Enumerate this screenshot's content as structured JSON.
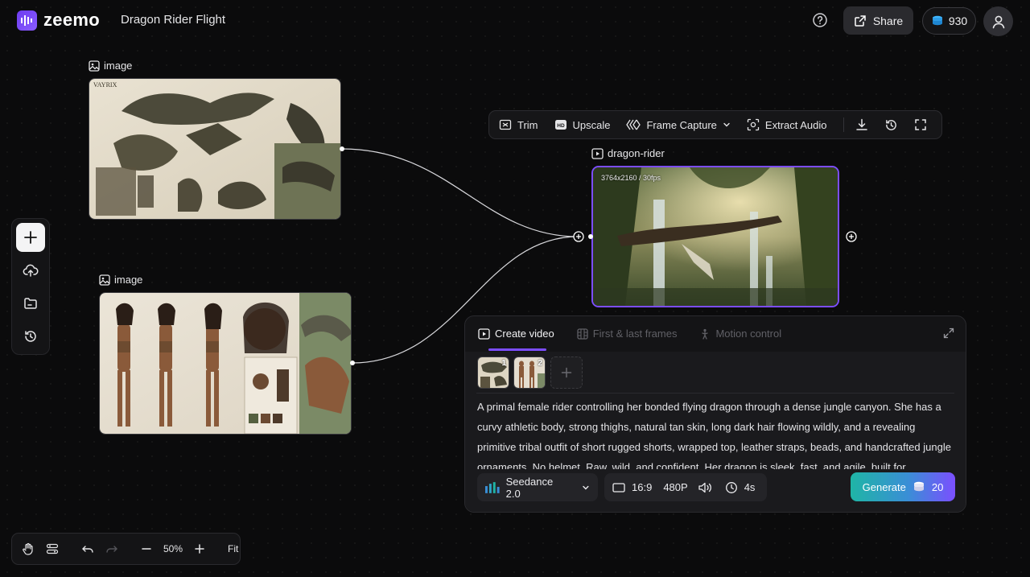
{
  "header": {
    "logo_text": "zeemo",
    "project_title": "Dragon Rider Flight",
    "share_label": "Share",
    "credits": "930"
  },
  "nodes": {
    "image1": {
      "label": "image"
    },
    "image2": {
      "label": "image"
    },
    "video": {
      "label": "dragon-rider",
      "meta": "3764x2160 / 30fps"
    }
  },
  "sidebar": {
    "items": [
      "add-icon",
      "upload-icon",
      "folder-icon",
      "history-icon"
    ]
  },
  "toolbar": {
    "trim": "Trim",
    "upscale": "Upscale",
    "frame_capture": "Frame Capture",
    "extract_audio": "Extract Audio"
  },
  "panel": {
    "tabs": [
      {
        "label": "Create video",
        "active": true
      },
      {
        "label": "First & last frames",
        "active": false
      },
      {
        "label": "Motion control",
        "active": false
      }
    ],
    "thumbs": [
      "1",
      "2"
    ],
    "prompt": "A primal female rider controlling her bonded flying dragon through a dense jungle canyon. She has a curvy athletic body, strong thighs, natural tan skin, long dark hair flowing wildly, and a revealing primitive tribal outfit of short rugged shorts, wrapped top, leather straps, beads, and handcrafted jungle ornaments. No helmet. Raw, wild, and confident. Her dragon is sleek, fast, and agile, built for",
    "model": "Seedance 2.0",
    "aspect": "16:9",
    "resolution": "480P",
    "duration": "4s",
    "generate_label": "Generate",
    "generate_cost": "20"
  },
  "bottombar": {
    "zoom": "50%",
    "fit": "Fit"
  },
  "colors": {
    "accent": "#7c4dff",
    "background": "#0b0b0c"
  }
}
